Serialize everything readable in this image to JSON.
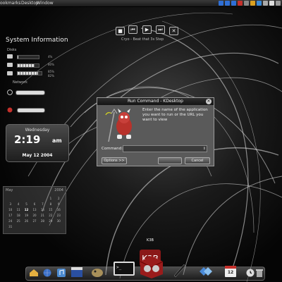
{
  "menubar": {
    "items": [
      "ookmarks",
      "Desktop",
      "Window"
    ]
  },
  "media": {
    "buttons": [
      "prev",
      "stop",
      "play",
      "next",
      "close"
    ],
    "track": "Cryo - Beat that 3s Step"
  },
  "system_info": {
    "title": "System Information",
    "disks_label": "Disks",
    "disk_values": [
      "4%",
      "80%",
      "85%",
      "82%"
    ],
    "network_label": "Network"
  },
  "clock": {
    "day": "Wednesday",
    "time": "2:19",
    "ampm": "am",
    "date": "May 12 2004"
  },
  "calendar": {
    "month": "May",
    "year": "2004",
    "days": [
      "",
      "",
      "",
      "",
      "",
      "1",
      "2",
      "3",
      "4",
      "5",
      "6",
      "7",
      "8",
      "9",
      "10",
      "11",
      "12",
      "13",
      "14",
      "15",
      "16",
      "17",
      "18",
      "19",
      "20",
      "21",
      "22",
      "23",
      "24",
      "25",
      "26",
      "27",
      "28",
      "29",
      "30",
      "31"
    ],
    "today": "12"
  },
  "dialog": {
    "title": "Run Command - KDesktop",
    "prompt": "Enter the name of the application you want to run or the URL you want to view",
    "command_label": "Command:",
    "command_value": "",
    "options_label": "Options >>",
    "run_label": "",
    "cancel_label": "Cancel"
  },
  "dock": {
    "k3b_label": "K3B",
    "calendar_date": "12",
    "items": [
      "home-icon",
      "globe-icon",
      "music-icon",
      "clapper-icon",
      "gimp-icon",
      "terminal-icon",
      "k3b-icon",
      "pen-icon",
      "network-icon",
      "calendar-icon",
      "clock-icon",
      "trash-icon"
    ]
  },
  "colors": {
    "background": "#0c0c0c",
    "dialog": "#5a5a5a",
    "tray_blue": "#2f6fd6",
    "tray_red": "#c4302b"
  }
}
